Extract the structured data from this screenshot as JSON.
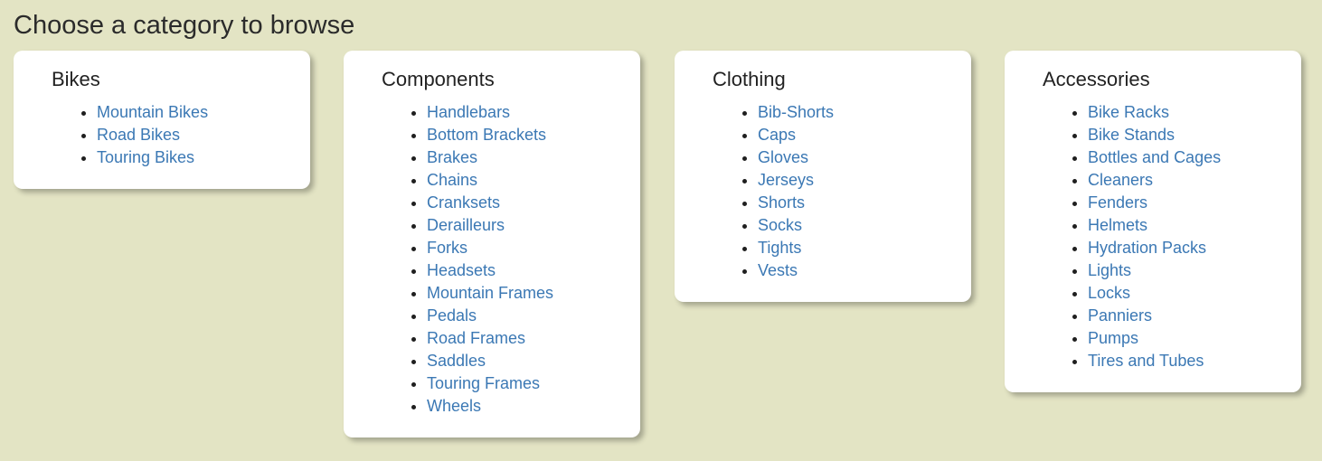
{
  "page": {
    "title": "Choose a category to browse"
  },
  "categories": [
    {
      "title": "Bikes",
      "items": [
        "Mountain Bikes",
        "Road Bikes",
        "Touring Bikes"
      ]
    },
    {
      "title": "Components",
      "items": [
        "Handlebars",
        "Bottom Brackets",
        "Brakes",
        "Chains",
        "Cranksets",
        "Derailleurs",
        "Forks",
        "Headsets",
        "Mountain Frames",
        "Pedals",
        "Road Frames",
        "Saddles",
        "Touring Frames",
        "Wheels"
      ]
    },
    {
      "title": "Clothing",
      "items": [
        "Bib-Shorts",
        "Caps",
        "Gloves",
        "Jerseys",
        "Shorts",
        "Socks",
        "Tights",
        "Vests"
      ]
    },
    {
      "title": "Accessories",
      "items": [
        "Bike Racks",
        "Bike Stands",
        "Bottles and Cages",
        "Cleaners",
        "Fenders",
        "Helmets",
        "Hydration Packs",
        "Lights",
        "Locks",
        "Panniers",
        "Pumps",
        "Tires and Tubes"
      ]
    }
  ],
  "colors": {
    "background": "#e3e4c4",
    "card": "#ffffff",
    "link": "#3b78b4"
  }
}
